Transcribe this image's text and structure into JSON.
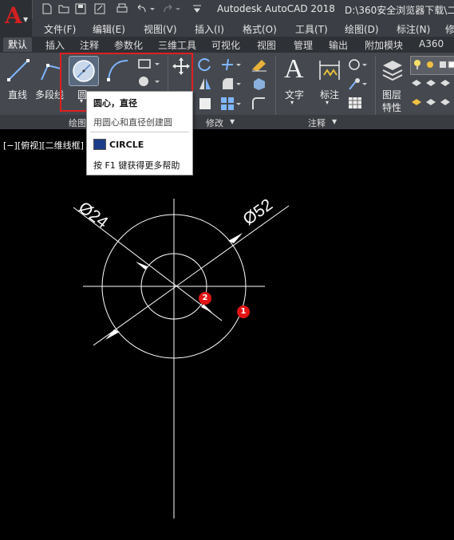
{
  "app": {
    "logo_letter": "A",
    "title": "Autodesk AutoCAD 2018",
    "path": "D:\\360安全浏览器下载\\二"
  },
  "menu": [
    "文件(F)",
    "编辑(E)",
    "视图(V)",
    "插入(I)",
    "格式(O)",
    "工具(T)",
    "绘图(D)",
    "标注(N)",
    "修"
  ],
  "tabs": [
    "默认",
    "插入",
    "注释",
    "参数化",
    "三维工具",
    "可视化",
    "视图",
    "管理",
    "输出",
    "附加模块",
    "A360"
  ],
  "active_tab": "默认",
  "ribbon": {
    "line_label": "直线",
    "polyline_label": "多段线",
    "circle_label": "圆",
    "text_label": "文字",
    "dim_label": "标注",
    "layer_label_1": "图层",
    "layer_label_2": "特性",
    "text_glyph": "A"
  },
  "panels": {
    "draw": "绘图",
    "modify": "修改",
    "annotation": "注释"
  },
  "tooltip": {
    "title": "圆心，直径",
    "description": "用圆心和直径创建圆",
    "command": "CIRCLE",
    "help": "按 F1 键获得更多帮助"
  },
  "viewport_label": "[−][俯视][二维线框]",
  "drawing": {
    "dim_large": "Ø52",
    "dim_small": "Ø24",
    "badge_1": "1",
    "badge_2": "2"
  },
  "colors": {
    "highlight": "#e02020",
    "badge": "#e01414",
    "logo": "#d32020"
  }
}
